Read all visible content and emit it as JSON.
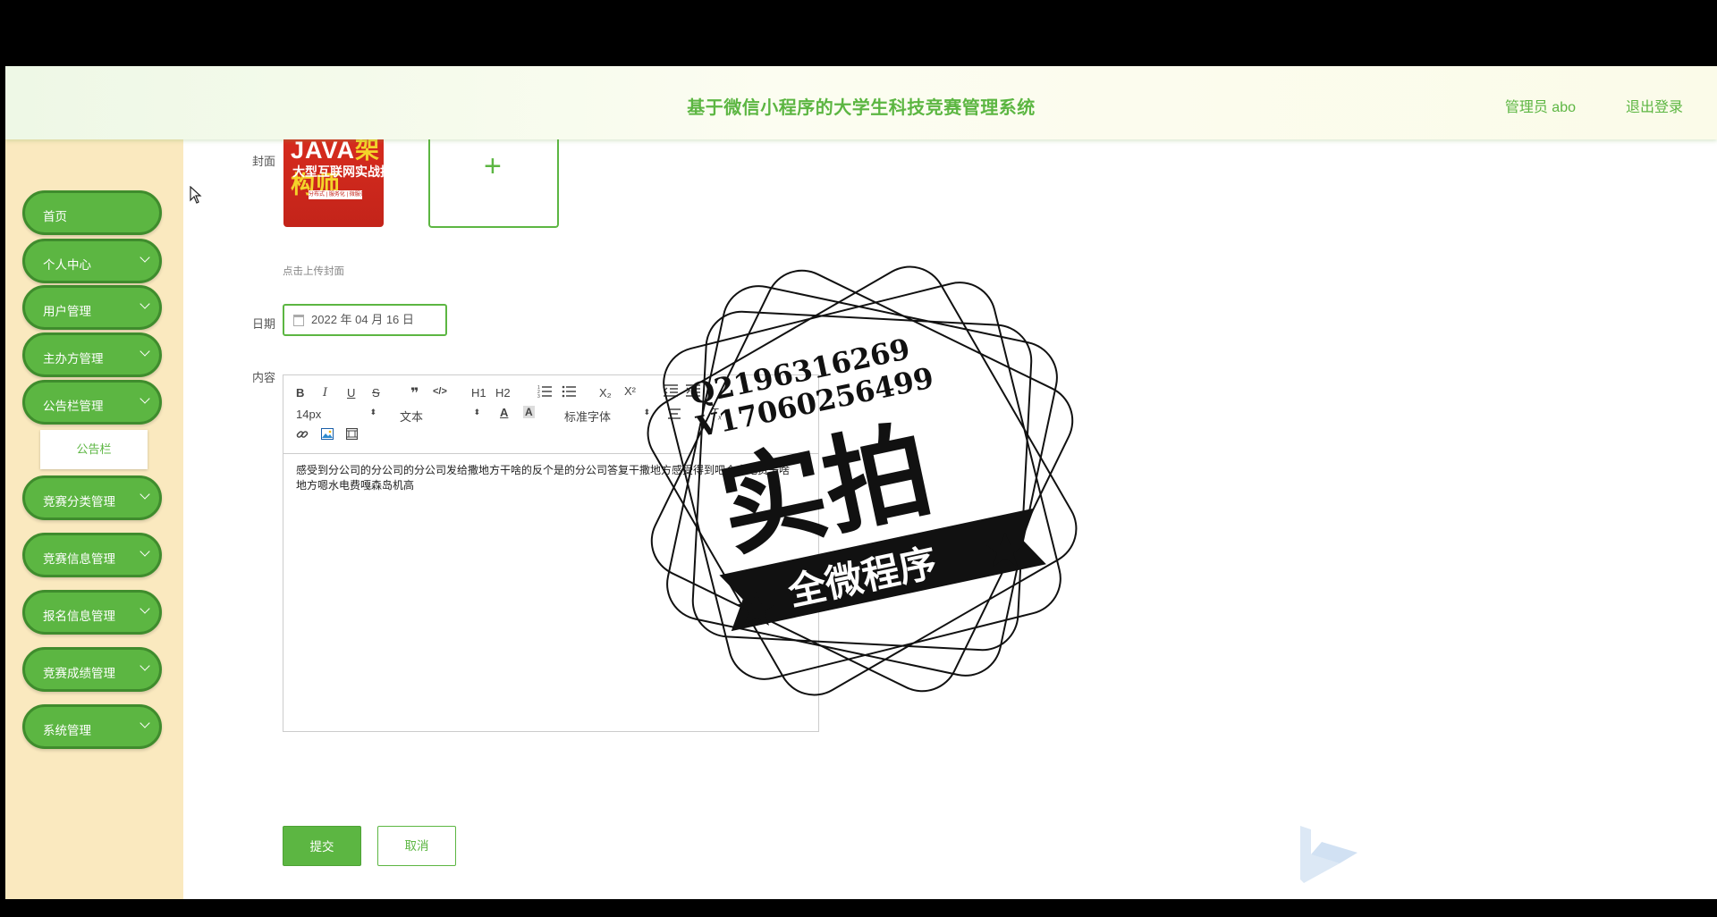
{
  "header": {
    "title": "基于微信小程序的大学生科技竞赛管理系统",
    "user": "管理员 abo",
    "logout": "退出登录"
  },
  "sidebar": {
    "items": [
      {
        "label": "首页",
        "has_arrow": false
      },
      {
        "label": "个人中心",
        "has_arrow": true
      },
      {
        "label": "用户管理",
        "has_arrow": true
      },
      {
        "label": "主办方管理",
        "has_arrow": true
      },
      {
        "label": "公告栏管理",
        "has_arrow": true
      },
      {
        "label": "竞赛分类管理",
        "has_arrow": true
      },
      {
        "label": "竞赛信息管理",
        "has_arrow": true
      },
      {
        "label": "报名信息管理",
        "has_arrow": true
      },
      {
        "label": "竞赛成绩管理",
        "has_arrow": true
      },
      {
        "label": "系统管理",
        "has_arrow": true
      }
    ],
    "submenu": "公告栏"
  },
  "form": {
    "cover_label": "封面",
    "cover_image": {
      "line1_java": "JAVA",
      "line1_rest": "架构师",
      "line2": "大型互联网实战技术",
      "line3": "分布式 | 服务化 | 微服务 | 架构专题"
    },
    "upload_plus": "+",
    "upload_hint": "点击上传封面",
    "date_label": "日期",
    "date_value": "2022 年 04 月 16 日",
    "content_label": "内容",
    "content_text": "感受到分公司的分公司的分公司发给撒地方干啥的反个是的分公司答复干撒地方感受得到吧个水电费干啥地方嗯水电费嘎森岛机高",
    "submit": "提交",
    "cancel": "取消"
  },
  "editor_toolbar": {
    "row1": [
      "B",
      "I",
      "U",
      "S",
      "❞",
      "</>",
      "H1",
      "H2",
      "ordered-list",
      "bullet-list",
      "X₂",
      "X²",
      "outdent",
      "indent"
    ],
    "font_size": "14px",
    "block_type": "文本",
    "font_family": "标准字体",
    "row3": [
      "link-icon",
      "image-icon",
      "video-icon"
    ]
  },
  "watermark": {
    "qq": "Q2196316269",
    "wechat": "V17060256499",
    "main": "实拍",
    "ribbon": "全微程序"
  },
  "colors": {
    "accent": "#5cb642",
    "sidebar_bg": "#fae9bf",
    "border_dark": "#3f8c2d"
  }
}
